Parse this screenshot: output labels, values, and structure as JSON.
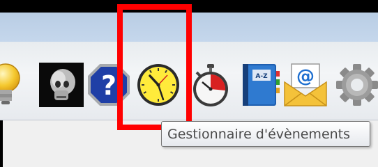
{
  "toolbar": {
    "tools": [
      {
        "icon": "lightbulb-icon"
      },
      {
        "icon": "skull-xray-icon"
      },
      {
        "icon": "help-icon",
        "label": "?"
      },
      {
        "icon": "clock-icon"
      },
      {
        "icon": "stopwatch-icon"
      },
      {
        "icon": "address-book-icon",
        "label": "A-Z"
      },
      {
        "icon": "email-icon",
        "label": "@"
      },
      {
        "icon": "gear-icon"
      }
    ]
  },
  "tooltip": {
    "text": "Gestionnaire d'évènements"
  },
  "colors": {
    "highlight": "#ff0000",
    "help_blue": "#1f3fa6",
    "clock_face": "#ffeb3b",
    "stopwatch_red": "#d82020"
  }
}
